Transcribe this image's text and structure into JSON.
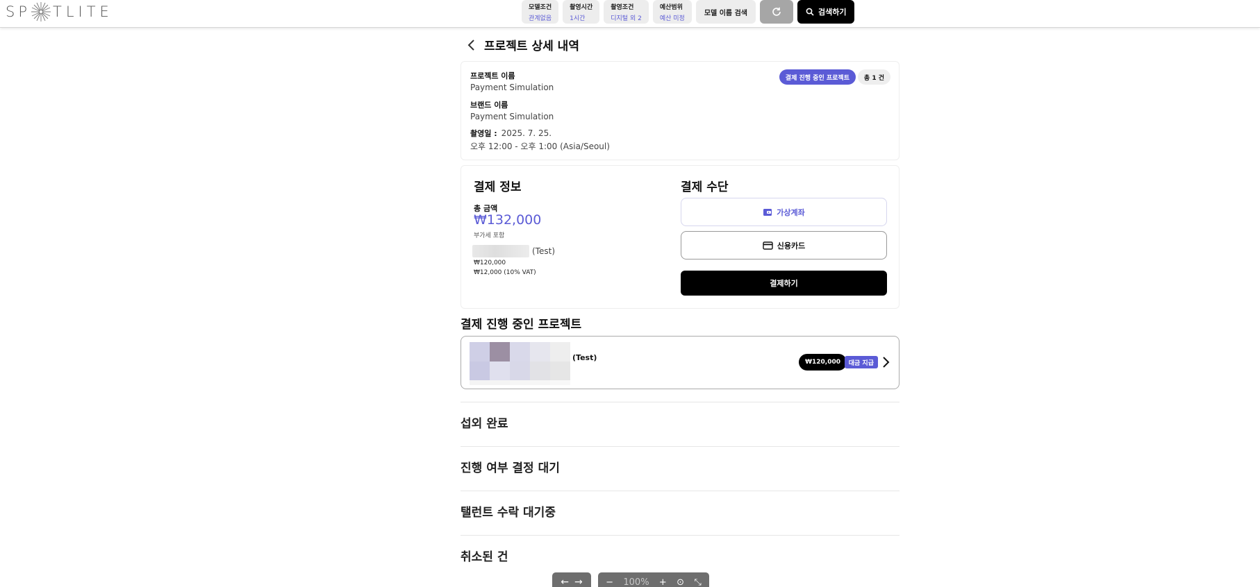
{
  "header": {
    "logo_text_left": "SP",
    "logo_text_right": "TLITE",
    "filters": [
      {
        "title": "모델조건",
        "value": "관계없음"
      },
      {
        "title": "촬영시간",
        "value": "1시간"
      },
      {
        "title": "촬영조건",
        "value": "디지털 외 2"
      },
      {
        "title": "예산범위",
        "value": "예산 미정"
      }
    ],
    "model_name_search": "모델 이름 검색",
    "search_label": "검색하기"
  },
  "page": {
    "title": "프로젝트 상세 내역"
  },
  "project_info": {
    "project_name_label": "프로젝트 이름",
    "project_name": "Payment Simulation",
    "brand_name_label": "브랜드 이름",
    "brand_name": "Payment Simulation",
    "shoot_date_label": "촬영일 :",
    "shoot_date": "2025. 7. 25.",
    "shoot_time": "오후 12:00 - 오후 1:00 (Asia/Seoul)",
    "status_badge": "결제 진행 중인 프로젝트",
    "count_badge": "총 1 건"
  },
  "payment_info": {
    "title": "결제 정보",
    "total_label": "총 금액",
    "total_amount": "₩132,000",
    "vat_note": "부가세 포함",
    "item_suffix": "(Test)",
    "item_price": "₩120,000",
    "item_vat": "₩12,000 (10% VAT)"
  },
  "payment_method": {
    "title": "결제 수단",
    "options": [
      "가상계좌",
      "신용카드"
    ],
    "selected": "가상계좌",
    "pay_button": "결제하기"
  },
  "in_progress": {
    "title": "결제 진행 중인 프로젝트",
    "project": {
      "name": "(Test)",
      "price": "₩120,000",
      "tag": "대금 지급"
    }
  },
  "sections": [
    "섭외 완료",
    "진행 여부 결정 대기",
    "탤런트 수락 대기중",
    "취소된 건"
  ],
  "viewer_toolbar": {
    "zoom": "100%"
  },
  "colors": {
    "accent": "#5b5bd6",
    "primary_button": "#000000"
  }
}
